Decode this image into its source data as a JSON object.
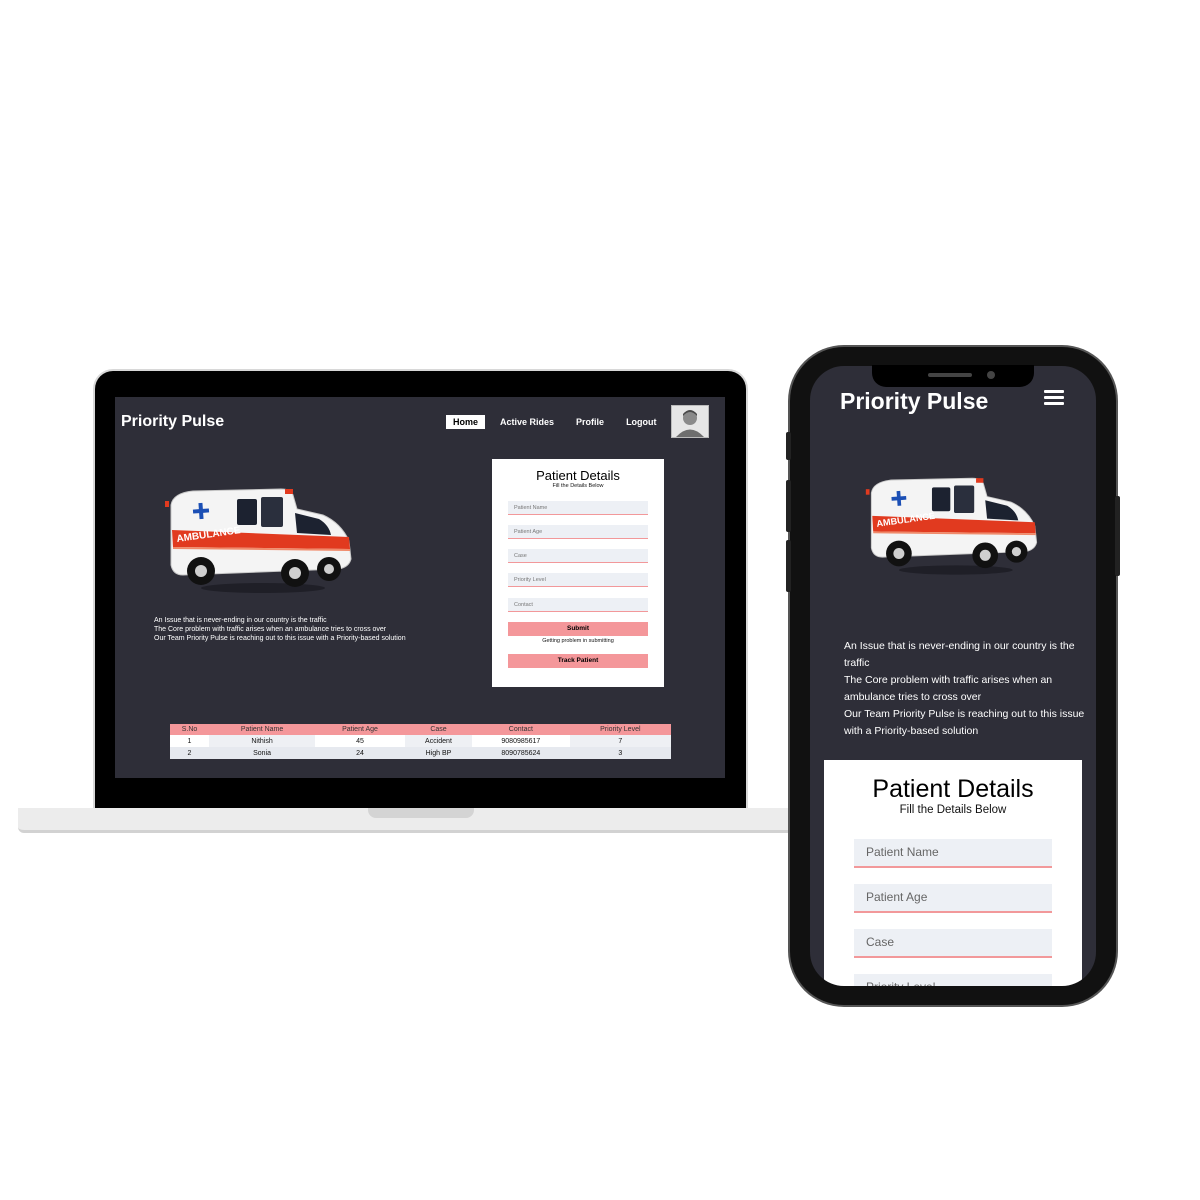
{
  "laptop": {
    "brand": "Priority Pulse",
    "nav": [
      "Home",
      "Active Rides",
      "Profile",
      "Logout"
    ],
    "ambulance_text": "AMBULANCE",
    "description": [
      "An Issue that is never-ending in our country is the traffic",
      "The Core problem with traffic arises when an ambulance tries to cross over",
      "Our Team Priority Pulse is reaching out to this issue with a Priority-based solution"
    ],
    "form": {
      "title": "Patient Details",
      "subtitle": "Fill the Details Below",
      "fields": [
        "Patient Name",
        "Patient Age",
        "Case",
        "Priority Level",
        "Contact"
      ],
      "submit": "Submit",
      "error": "Getting problem in submitting",
      "track": "Track Patient"
    },
    "table": {
      "headers": [
        "S.No",
        "Patient Name",
        "Patient Age",
        "Case",
        "Contact",
        "Priority Level"
      ],
      "rows": [
        [
          "1",
          "Nithish",
          "45",
          "Accident",
          "9080985617",
          "7"
        ],
        [
          "2",
          "Sonia",
          "24",
          "High BP",
          "8090785624",
          "3"
        ]
      ]
    }
  },
  "phone": {
    "brand": "Priority Pulse",
    "ambulance_text": "AMBULANCE",
    "description": [
      "An Issue that is never-ending in our country is the traffic",
      "The Core problem with traffic arises when an ambulance tries to cross over",
      "Our Team Priority Pulse is reaching out to this issue with a Priority-based solution"
    ],
    "form": {
      "title": "Patient Details",
      "subtitle": "Fill the Details Below",
      "fields": [
        "Patient Name",
        "Patient Age",
        "Case",
        "Priority Level"
      ]
    }
  },
  "colors": {
    "background": "#2e2e38",
    "accent": "#f4979a",
    "input_bg": "#edf0f5"
  },
  "icons": [
    "user-avatar-icon",
    "hamburger-menu-icon",
    "ambulance-illustration"
  ]
}
